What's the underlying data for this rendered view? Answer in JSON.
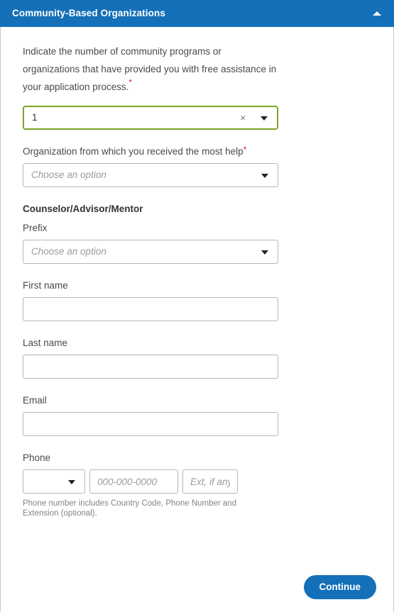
{
  "accordion": {
    "title": "Community-Based Organizations",
    "collapse_icon": "chevron-up-icon"
  },
  "intro": {
    "text": "Indicate the number of community programs or organizations that have provided you with free assistance in your application process.",
    "required_marker": "*"
  },
  "fields": {
    "count": {
      "value": "1",
      "clear_label": "×",
      "caret_icon": "chevron-down-icon",
      "state": "valid",
      "valid_border_color": "#7ba428"
    },
    "organization": {
      "label": "Organization from which you received the most help",
      "required_marker": "*",
      "placeholder": "Choose an option",
      "value": ""
    },
    "group_title": "Counselor/Advisor/Mentor",
    "prefix": {
      "label": "Prefix",
      "placeholder": "Choose an option",
      "value": ""
    },
    "first_name": {
      "label": "First name",
      "value": "",
      "placeholder": ""
    },
    "last_name": {
      "label": "Last name",
      "value": "",
      "placeholder": ""
    },
    "email": {
      "label": "Email",
      "value": "",
      "placeholder": ""
    },
    "phone": {
      "label": "Phone",
      "country_code_value": "",
      "number_placeholder": "000-000-0000",
      "number_value": "",
      "ext_placeholder": "Ext, if any",
      "ext_value": "",
      "help_text": "Phone number includes Country Code, Phone Number and Extension (optional)."
    }
  },
  "footer": {
    "continue_label": "Continue"
  },
  "colors": {
    "brand_blue": "#1470b8",
    "required_red": "#e3173e",
    "valid_green": "#7ba428"
  }
}
